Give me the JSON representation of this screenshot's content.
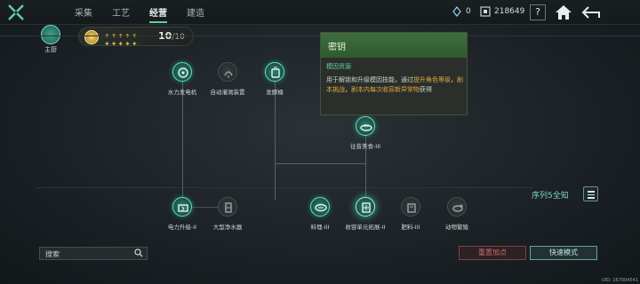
{
  "nav": {
    "tabs": [
      "采集",
      "工艺",
      "经营",
      "建造"
    ],
    "active_index": 2
  },
  "resources": {
    "currency1": "0",
    "currency2": "218649"
  },
  "topbar": {
    "help": "?"
  },
  "avatar": {
    "label": "主厨"
  },
  "rank": {
    "current": "10",
    "max": "/10"
  },
  "nodes": [
    {
      "label": "水力发电机",
      "active": true
    },
    {
      "label": "自动灌溉装置",
      "active": false
    },
    {
      "label": "发酵桶",
      "active": true
    },
    {
      "label": "往昔美食-III",
      "active": true
    },
    {
      "label": "电力升级-II",
      "active": true
    },
    {
      "label": "大型净水器",
      "active": false
    },
    {
      "label": "料理-III",
      "active": true
    },
    {
      "label": "收容单元拓展-II",
      "active": true
    },
    {
      "label": "肥料-III",
      "active": false
    },
    {
      "label": "动物繁殖",
      "active": false
    }
  ],
  "tooltip": {
    "title": "密钥",
    "category": "模因资源",
    "desc_a": "用于解锁和升级模因技能，通过",
    "desc_hl1": "提升角色等级",
    "desc_b": "，",
    "desc_hl2": "剧本挑战",
    "desc_c": "，",
    "desc_hl3": "剧本内每次收容新异常物",
    "desc_d": "获得"
  },
  "sequence": {
    "label": "序列5全知"
  },
  "search": {
    "placeholder": "搜索"
  },
  "buttons": {
    "reset": "重置加点",
    "quick": "快速模式"
  },
  "uid": "UID: 167004541",
  "colors": {
    "accent": "#5fd1a2",
    "highlight": "#e0a63b",
    "reset": "#d4686c"
  }
}
